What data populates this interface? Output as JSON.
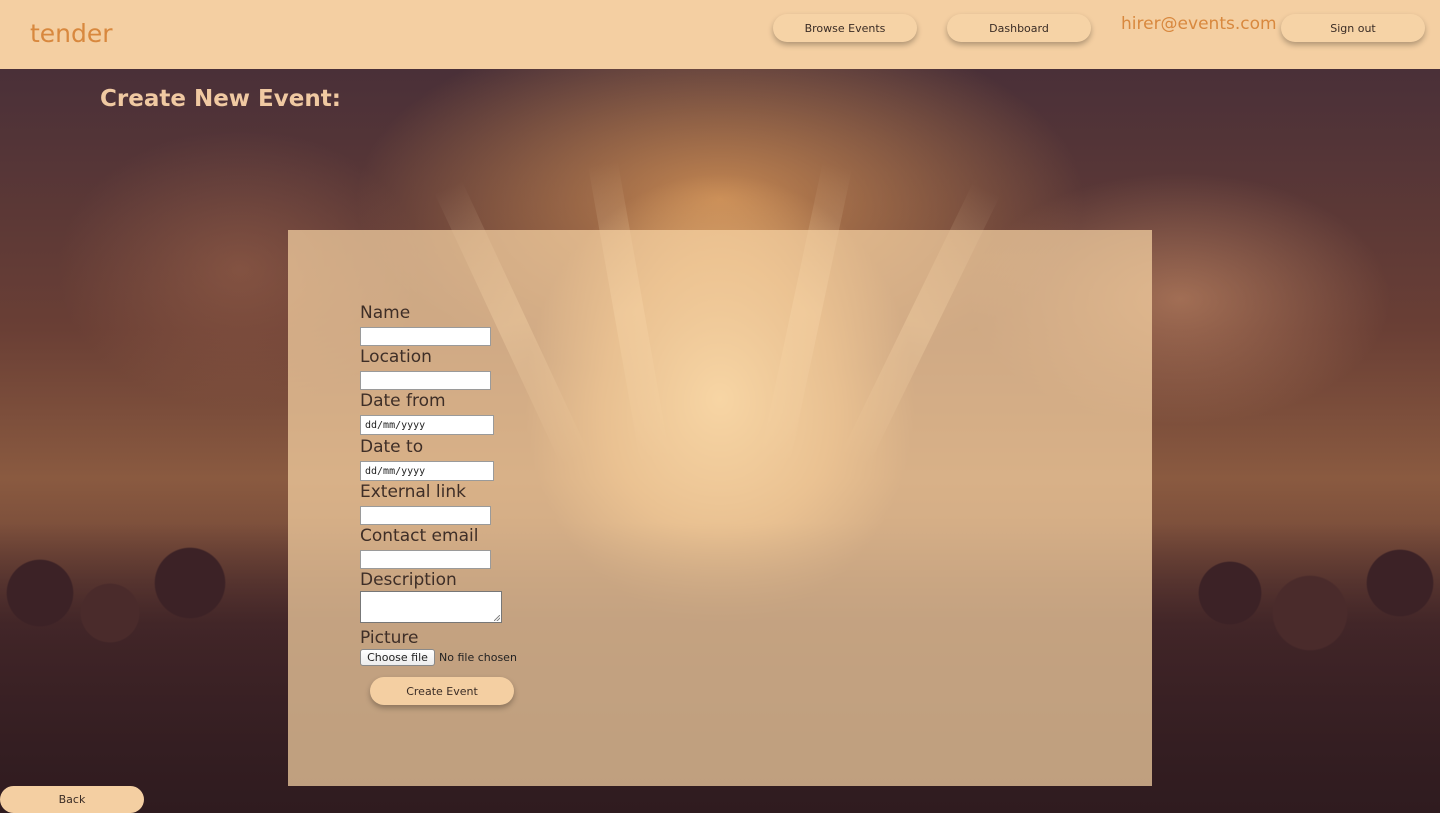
{
  "header": {
    "logo": "tender",
    "nav": {
      "browse_events": "Browse Events",
      "dashboard": "Dashboard"
    },
    "user_email": "hirer@events.com",
    "sign_out": "Sign out"
  },
  "page": {
    "title": "Create New Event:"
  },
  "form": {
    "name_label": "Name",
    "location_label": "Location",
    "date_from_label": "Date from",
    "date_from_placeholder": "dd/mm/yyyy",
    "date_to_label": "Date to",
    "date_to_placeholder": "dd/mm/yyyy",
    "external_link_label": "External link",
    "contact_email_label": "Contact email",
    "description_label": "Description",
    "picture_label": "Picture",
    "choose_file": "Choose file",
    "file_status": "No file chosen",
    "submit": "Create Event"
  },
  "footer": {
    "back": "Back"
  },
  "colors": {
    "header_bg": "#f4cfa2",
    "accent": "#d8883e",
    "panel_bg": "#f7d2a4",
    "button_bg": "#f4cfa2"
  }
}
